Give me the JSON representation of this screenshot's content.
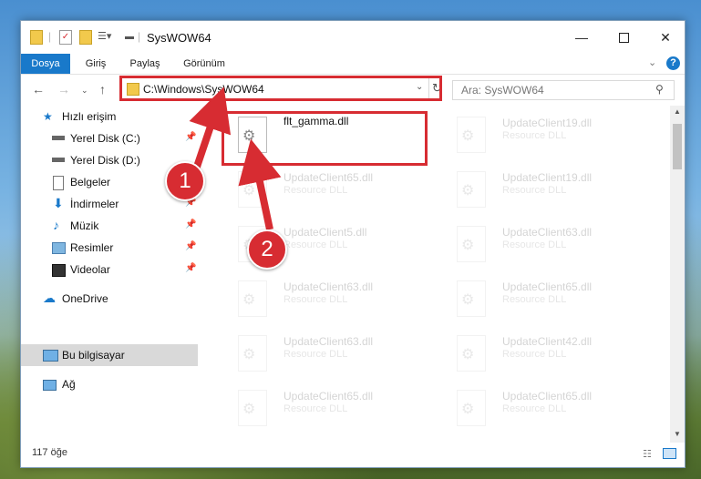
{
  "window": {
    "title": "SysWOW64",
    "minimize_icon": "minimize-icon",
    "maximize_icon": "maximize-icon",
    "close_icon": "close-icon"
  },
  "ribbon": {
    "tabs": [
      {
        "label": "Dosya",
        "active": true
      },
      {
        "label": "Giriş"
      },
      {
        "label": "Paylaş"
      },
      {
        "label": "Görünüm"
      }
    ]
  },
  "address": {
    "path": "C:\\Windows\\SysWOW64",
    "search_placeholder": "Ara: SysWOW64"
  },
  "sidebar": {
    "items": [
      {
        "label": "Hızlı erişim",
        "icon": "star-icon"
      },
      {
        "label": "Yerel Disk (C:)",
        "icon": "drive-icon",
        "pinned": true
      },
      {
        "label": "Yerel Disk (D:)",
        "icon": "drive-icon"
      },
      {
        "label": "Belgeler",
        "icon": "documents-icon",
        "pinned": true
      },
      {
        "label": "İndirmeler",
        "icon": "download-icon",
        "pinned": true
      },
      {
        "label": "Müzik",
        "icon": "music-icon",
        "pinned": true
      },
      {
        "label": "Resimler",
        "icon": "pictures-icon",
        "pinned": true
      },
      {
        "label": "Videolar",
        "icon": "video-icon",
        "pinned": true
      },
      {
        "label": "OneDrive",
        "icon": "cloud-icon"
      },
      {
        "label": "Bu bilgisayar",
        "icon": "computer-icon",
        "selected": true
      },
      {
        "label": "Ağ",
        "icon": "network-icon"
      }
    ]
  },
  "files": [
    {
      "name": "flt_gamma.dll",
      "type": ""
    },
    {
      "name": "UpdateClient19.dll",
      "type": "Resource DLL"
    },
    {
      "name": "UpdateClient65.dll",
      "type": "Resource DLL"
    },
    {
      "name": "UpdateClient19.dll",
      "type": "Resource DLL"
    },
    {
      "name": "UpdateClient5.dll",
      "type": "Resource DLL"
    },
    {
      "name": "UpdateClient63.dll",
      "type": "Resource DLL"
    },
    {
      "name": "UpdateClient63.dll",
      "type": "Resource DLL"
    },
    {
      "name": "UpdateClient65.dll",
      "type": "Resource DLL"
    },
    {
      "name": "UpdateClient63.dll",
      "type": "Resource DLL"
    },
    {
      "name": "UpdateClient42.dll",
      "type": "Resource DLL"
    },
    {
      "name": "UpdateClient65.dll",
      "type": "Resource DLL"
    },
    {
      "name": "UpdateClient65.dll",
      "type": "Resource DLL"
    }
  ],
  "status": {
    "count": "117 öğe"
  },
  "callouts": [
    "1",
    "2"
  ],
  "colors": {
    "accent": "#1979ca",
    "highlight": "#d72c32"
  }
}
